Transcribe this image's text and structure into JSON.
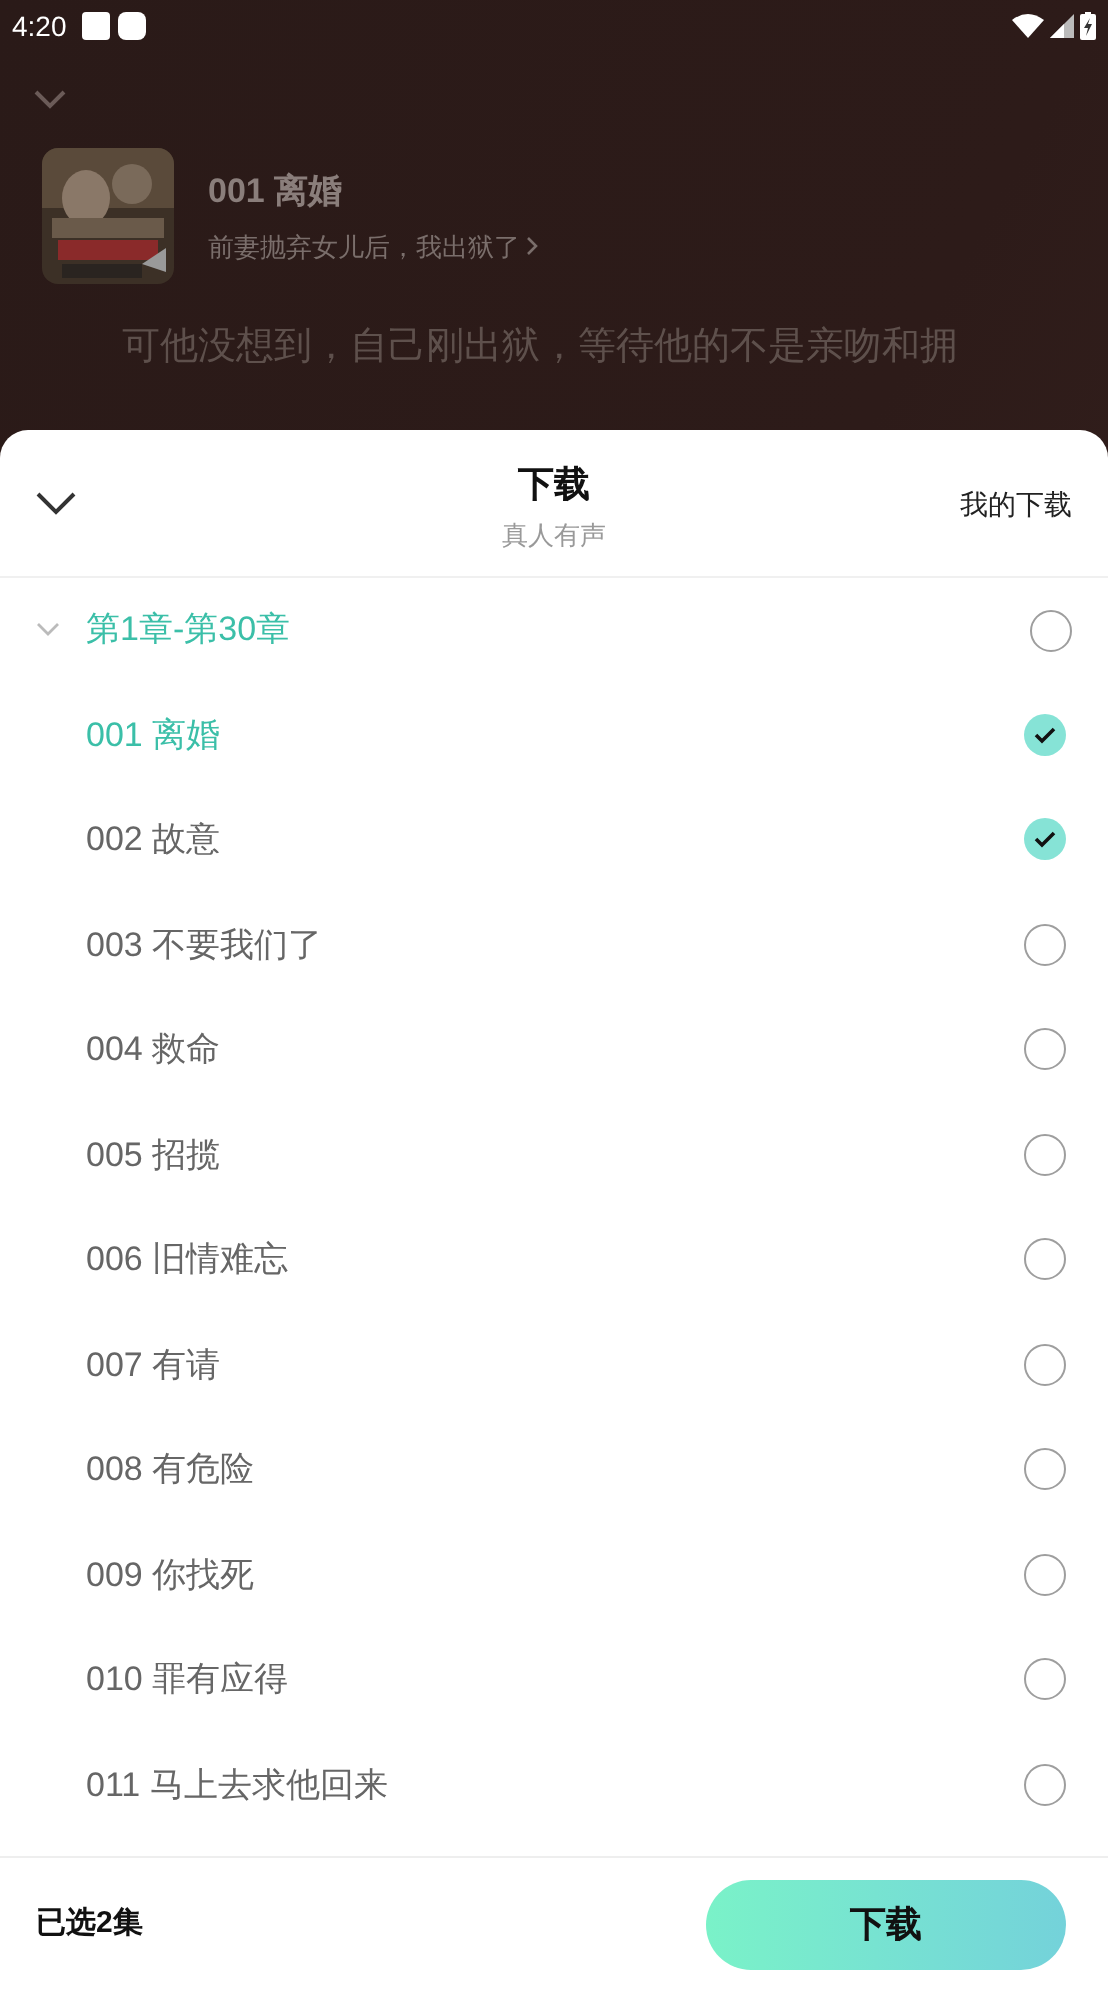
{
  "status_bar": {
    "time": "4:20"
  },
  "player": {
    "title": "001 离婚",
    "book": "前妻抛弃女儿后，我出狱了",
    "text_lines": [
      "可他没想到，自己刚出狱，等待他的不是亲吻和拥"
    ]
  },
  "sheet": {
    "title": "下载",
    "subtitle": "真人有声",
    "my_downloads": "我的下载",
    "groups": [
      {
        "label": "第1章-第30章",
        "expanded": true,
        "checked": false,
        "children": [
          {
            "label": "001 离婚",
            "checked": true,
            "current": true
          },
          {
            "label": "002 故意",
            "checked": true,
            "current": false
          },
          {
            "label": "003 不要我们了",
            "checked": false,
            "current": false
          },
          {
            "label": "004 救命",
            "checked": false,
            "current": false
          },
          {
            "label": "005 招揽",
            "checked": false,
            "current": false
          },
          {
            "label": "006 旧情难忘",
            "checked": false,
            "current": false
          },
          {
            "label": "007 有请",
            "checked": false,
            "current": false
          },
          {
            "label": "008 有危险",
            "checked": false,
            "current": false
          },
          {
            "label": "009 你找死",
            "checked": false,
            "current": false
          },
          {
            "label": "010 罪有应得",
            "checked": false,
            "current": false
          },
          {
            "label": "011 马上去求他回来",
            "checked": false,
            "current": false
          }
        ]
      }
    ],
    "selected_count": "已选2集",
    "download_button": "下载"
  }
}
